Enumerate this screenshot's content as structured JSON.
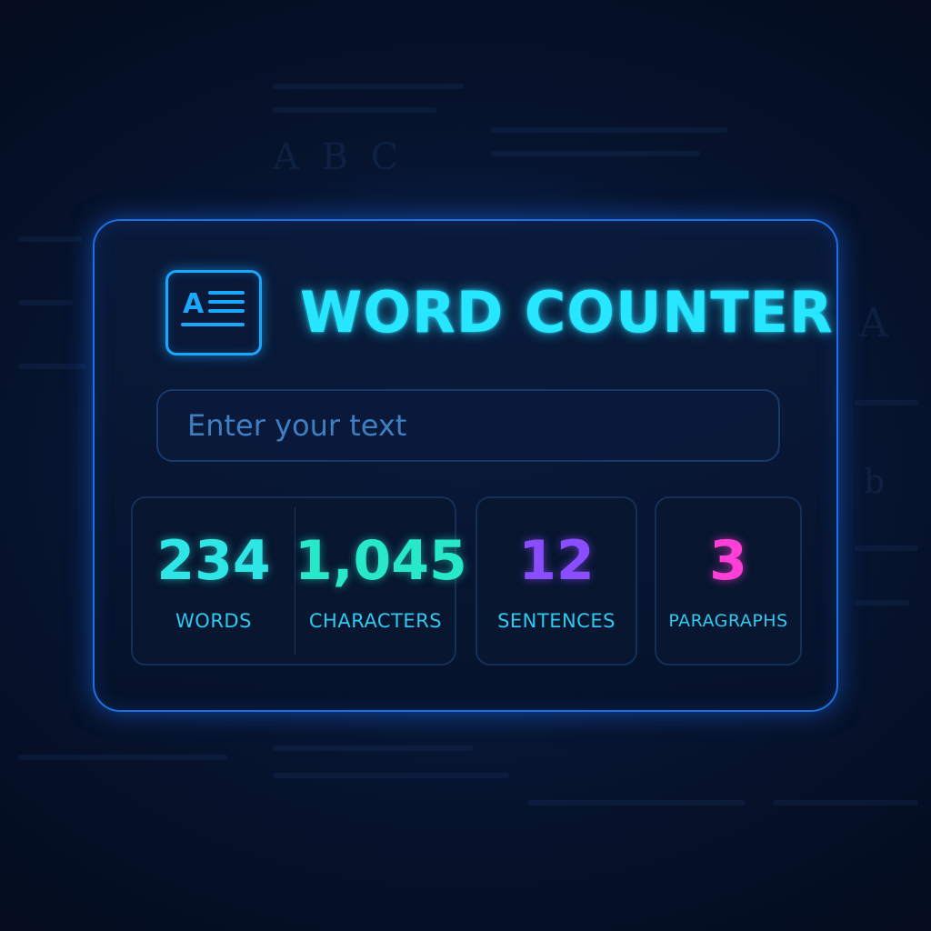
{
  "app": {
    "title": "WORD COUNTER",
    "logo_icon": "text-document-icon",
    "logo_text": "A"
  },
  "input": {
    "placeholder": "Enter your text",
    "value": ""
  },
  "stats": {
    "words": {
      "value": "234",
      "label": "WORDS",
      "color": "#2ee6e6"
    },
    "characters": {
      "value": "1,045",
      "label": "CHARACTERS",
      "color": "#27e8c8"
    },
    "sentences": {
      "value": "12",
      "label": "SENTENCES",
      "color": "#8a4dff"
    },
    "paragraphs": {
      "value": "3",
      "label": "PARAGRAPHS",
      "color": "#ff3fd8"
    }
  },
  "colors": {
    "accent": "#27e6ff",
    "border": "#1e6ee8",
    "background": "#06132d"
  }
}
